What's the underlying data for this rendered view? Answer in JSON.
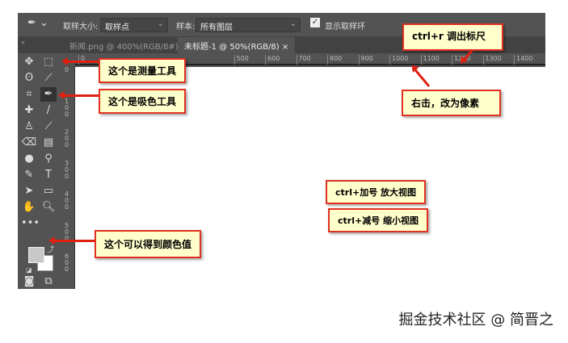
{
  "options_bar": {
    "sample_size_label": "取样大小:",
    "sample_size_value": "取样点",
    "sample_label": "样本:",
    "sample_value": "所有图层",
    "show_ring_label": "显示取样环",
    "show_ring_checked": true
  },
  "tabs": [
    {
      "label": "新闻.png @ 400%(RGB/8#)",
      "close": "×"
    },
    {
      "label": "未标题-1 @ 50%(RGB/8)",
      "close": "×"
    }
  ],
  "ruler_h": [
    "0",
    "500",
    "600",
    "700",
    "800",
    "900",
    "1000",
    "1100",
    "1200",
    "1300",
    "1400"
  ],
  "ruler_v": [
    "0",
    "100",
    "200",
    "300",
    "400",
    "500",
    "600"
  ],
  "annotations": {
    "measure": "这个是测量工具",
    "eyedropper": "这个是吸色工具",
    "color": "这个可以得到颜色值",
    "ruler": "ctrl+r 调出标尺",
    "pixels": "右击，改为像素",
    "zoom_in": "ctrl+加号 放大视图",
    "zoom_out": "ctrl+减号 缩小视图"
  },
  "watermark": "掘金技术社区 @ 简晋之",
  "colors": {
    "foreground": "#c8c8c8",
    "background": "#ffffff",
    "annotation_border": "#e03020"
  }
}
